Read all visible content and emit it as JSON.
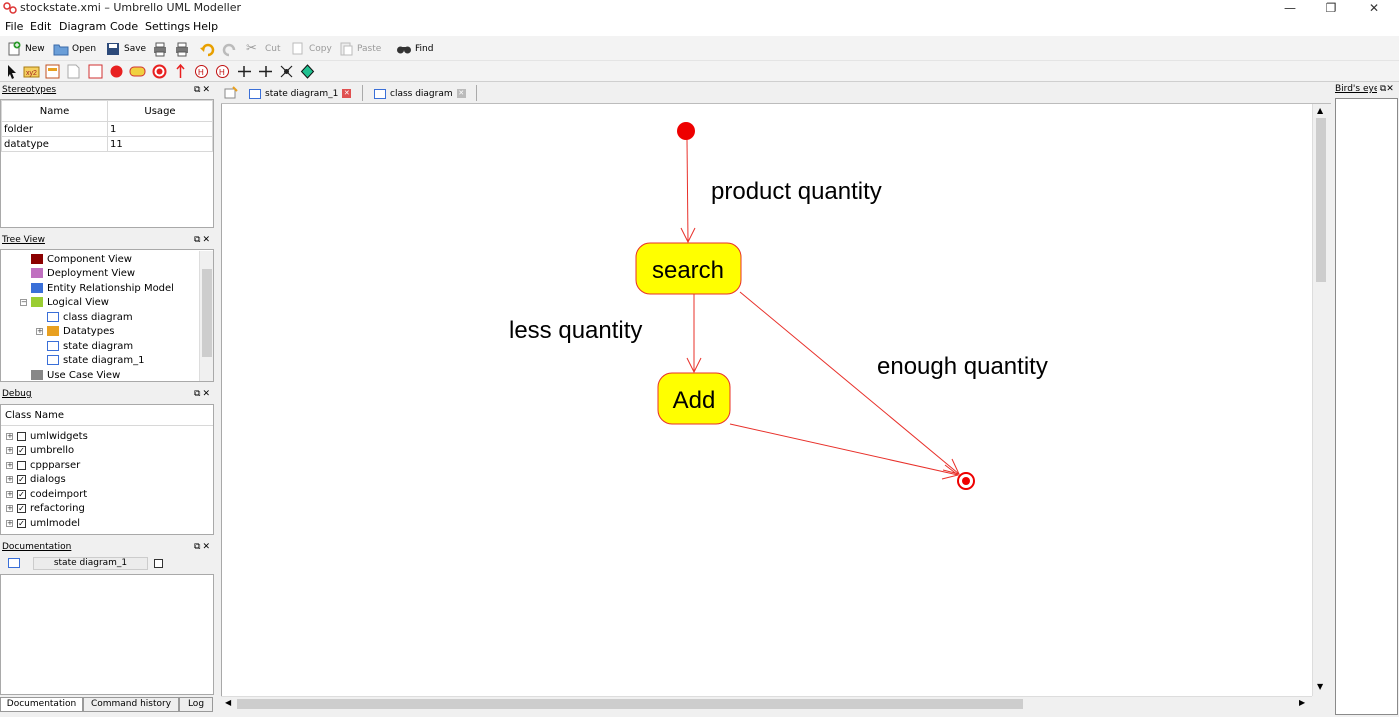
{
  "window": {
    "title": "stockstate.xmi – Umbrello UML Modeller",
    "minimize": "—",
    "maximize": "❐",
    "close": "✕"
  },
  "menu": [
    "File",
    "Edit",
    "Diagram",
    "Code",
    "Settings",
    "Help"
  ],
  "toolbar": {
    "new": "New",
    "open": "Open",
    "save": "Save",
    "cut": "Cut",
    "copy": "Copy",
    "paste": "Paste",
    "find": "Find"
  },
  "stereotypes": {
    "title": "Stereotypes",
    "columns": [
      "Name",
      "Usage"
    ],
    "rows": [
      {
        "name": "folder",
        "usage": "1"
      },
      {
        "name": "datatype",
        "usage": "11"
      }
    ]
  },
  "tree_view": {
    "title": "Tree View",
    "items": [
      {
        "label": "Component View",
        "color": "#8b0000"
      },
      {
        "label": "Deployment View",
        "color": "#c070c0"
      },
      {
        "label": "Entity Relationship Model",
        "color": "#3a6fd8"
      },
      {
        "label": "Logical View",
        "color": "#9acd32"
      },
      {
        "label": "class diagram",
        "icon": "diagram-icon"
      },
      {
        "label": "Datatypes",
        "color": "#e8a020"
      },
      {
        "label": "state diagram",
        "icon": "diagram-icon"
      },
      {
        "label": "state diagram_1",
        "icon": "diagram-icon"
      },
      {
        "label": "Use Case View",
        "color": "#888888"
      }
    ]
  },
  "debug": {
    "title": "Debug",
    "column": "Class Name",
    "items": [
      {
        "label": "umlwidgets",
        "checked": false
      },
      {
        "label": "umbrello",
        "checked": true
      },
      {
        "label": "cppparser",
        "checked": false
      },
      {
        "label": "dialogs",
        "checked": true
      },
      {
        "label": "codeimport",
        "checked": true
      },
      {
        "label": "refactoring",
        "checked": true
      },
      {
        "label": "umlmodel",
        "checked": true
      }
    ]
  },
  "documentation": {
    "title": "Documentation",
    "diagram_name": "state diagram_1"
  },
  "bottom_tabs": [
    "Documentation",
    "Command history",
    "Log"
  ],
  "diagram_tabs": [
    {
      "label": "state diagram_1",
      "active": true
    },
    {
      "label": "class diagram",
      "active": false
    }
  ],
  "birds_eye": {
    "title": "Bird's eye"
  },
  "diagram": {
    "states": [
      {
        "name": "search"
      },
      {
        "name": "Add"
      }
    ],
    "transitions": [
      {
        "label": "product quantity"
      },
      {
        "label": "less quantity"
      },
      {
        "label": "enough quantity"
      }
    ],
    "colors": {
      "state_fill": "#ffff00",
      "line": "#e8302a",
      "initial": "#ee0000"
    }
  }
}
